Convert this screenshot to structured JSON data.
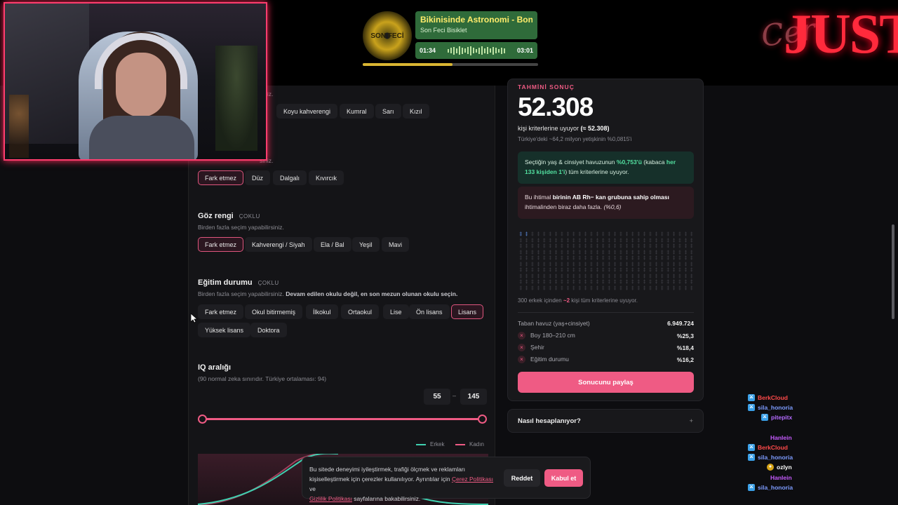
{
  "music": {
    "title": "Bikinisinde Astronomi - Boni",
    "artist": "Son Feci Bisiklet",
    "current_time": "01:34",
    "total_time": "03:01",
    "progress": 0.51,
    "disc_label": "SON FECİ"
  },
  "logo": {
    "main": "JUST",
    "script": "Cer"
  },
  "form": {
    "hair_color": {
      "sub_partial": "siniz.",
      "options": [
        "Koyu kahverengi",
        "Kumral",
        "Sarı",
        "Kızıl"
      ]
    },
    "hair_type": {
      "sub_partial": "siniz.",
      "options": [
        "Fark etmez",
        "Düz",
        "Dalgalı",
        "Kıvırcık"
      ],
      "selected": "Fark etmez"
    },
    "eye_color": {
      "title": "Göz rengi",
      "tag": "ÇOKLU",
      "sub": "Birden fazla seçim yapabilirsiniz.",
      "options": [
        "Fark etmez",
        "Kahverengi / Siyah",
        "Ela / Bal",
        "Yeşil",
        "Mavi"
      ],
      "selected": "Fark etmez"
    },
    "education": {
      "title": "Eğitim durumu",
      "tag": "ÇOKLU",
      "sub": "Birden fazla seçim yapabilirsiniz.",
      "sub_bold": "Devam edilen okulu değil, en son mezun olunan okulu seçin.",
      "options": [
        "Fark etmez",
        "Okul bitirmemiş",
        "İlkokul",
        "Ortaokul",
        "Lise",
        "Ön lisans",
        "Lisans",
        "Yüksek lisans",
        "Doktora"
      ],
      "selected": "Lisans"
    },
    "iq": {
      "title": "IQ aralığı",
      "sub": "(90 normal zeka sınırıdır. Türkiye ortalaması: 94)",
      "min": "55",
      "max": "145",
      "separator": "–",
      "legend_male": "Erkek",
      "legend_female": "Kadın"
    }
  },
  "result": {
    "label": "TAHMİNİ SONUÇ",
    "number": "52.308",
    "line1_text": "kişi kriterlerine uyuyor",
    "line1_bold": "(≈ 52.308)",
    "line2": "Türkiye'deki ~64,2 milyon yetişkinin %0,0815'i",
    "green_box": {
      "pre": "Seçtiğin yaş & cinsiyet havuzunun ",
      "pct": "%0,753'ü",
      "mid": " (kabaca ",
      "ratio": "her 133 kişiden 1'i",
      "post": ") tüm kriterlerine uyuyor."
    },
    "red_box": {
      "pre": "Bu ihtimal ",
      "bold": "birinin AB Rh− kan grubuna sahip olması",
      "post": " ihtimalinden biraz daha fazla. ",
      "pct": "(%0,6)"
    },
    "grid_caption_pre": "300 erkek içinden ",
    "grid_caption_num": "~2",
    "grid_caption_post": " kişi tüm kriterlerine uyuyor.",
    "grid_total": 300,
    "grid_hits": 2,
    "base_label": "Taban havuz (yaş+cinsiyet)",
    "base_value": "6.949.724",
    "rows": [
      {
        "label": "Boy 180–210 cm",
        "value": "%25,3"
      },
      {
        "label": "Şehir",
        "value": "%18,4"
      },
      {
        "label": "Eğitim durumu",
        "value": "%16,2"
      }
    ],
    "share_label": "Sonucunu paylaş",
    "how_label": "Nasıl hesaplanıyor?",
    "how_icon": "+"
  },
  "cookie": {
    "text_pre": "Bu sitede deneyimi iyileştirmek, trafiği ölçmek ve reklamları kişiselleştirmek için çerezler kullanılıyor. Ayrıntılar için ",
    "link1": "Çerez Politikası",
    "text_mid": " ve ",
    "link2": "Gizlilik Politikası",
    "text_post": " sayfalarına bakabilirsiniz.",
    "reject": "Reddet",
    "accept": "Kabul et"
  },
  "chat": [
    {
      "user": "BerkCloud",
      "color": "#ff4a4a",
      "badge": "sub"
    },
    {
      "user": "sila_honoria",
      "color": "#7d9cff",
      "badge": "sub"
    },
    {
      "user": "pitepitx",
      "color": "#b46bff",
      "badge": "sub"
    },
    {
      "user": "Hanlein",
      "color": "#c65bff",
      "badge": ""
    },
    {
      "user": "BerkCloud",
      "color": "#ff4a4a",
      "badge": "sub"
    },
    {
      "user": "sila_honoria",
      "color": "#7d9cff",
      "badge": "sub"
    },
    {
      "user": "ozlyn",
      "color": "#ffffff",
      "badge": "coin"
    },
    {
      "user": "Hanlein",
      "color": "#c65bff",
      "badge": ""
    },
    {
      "user": "sila_honoria",
      "color": "#7d9cff",
      "badge": "sub"
    }
  ],
  "colors": {
    "accent": "#ef5b84",
    "male": "#3fd0b0",
    "female": "#ef5b84"
  }
}
